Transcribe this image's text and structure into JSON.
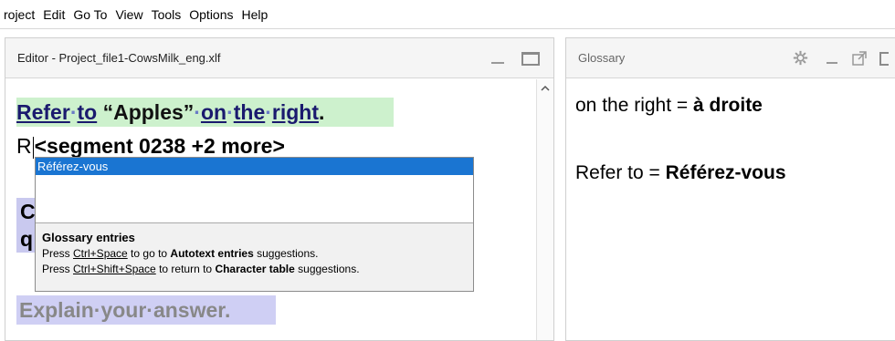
{
  "menubar": {
    "items": [
      "roject",
      "Edit",
      "Go To",
      "View",
      "Tools",
      "Options",
      "Help"
    ]
  },
  "editor": {
    "title": "Editor - Project_file1-CowsMilk_eng.xlf",
    "segment1": {
      "refer": "Refer",
      "dot1": "·",
      "to": "to",
      "space": " ",
      "apples": "“Apples”",
      "dot2": "·",
      "on": "on",
      "dot3": "·",
      "the": "the",
      "dot4": "·",
      "right": "right",
      "period": "."
    },
    "segment2": {
      "start": "R",
      "tag": "<segment 0238 +2 more>"
    },
    "segment3": {
      "line1": "C",
      "line2": "q"
    },
    "segment4": {
      "text": "Explain·your·answer."
    }
  },
  "popup": {
    "selected_item": "Référez-vous",
    "info_title": "Glossary entries",
    "line1_pre": "Press ",
    "line1_key": "Ctrl+Space",
    "line1_mid": " to go to ",
    "line1_bold": "Autotext entries",
    "line1_post": " suggestions.",
    "line2_pre": "Press ",
    "line2_key": "Ctrl+Shift+Space",
    "line2_mid": " to return to ",
    "line2_bold": "Character table",
    "line2_post": " suggestions."
  },
  "glossary": {
    "title": "Glossary",
    "entries": [
      {
        "source": "on the right = ",
        "target": "à droite"
      },
      {
        "source": "Refer to = ",
        "target": "Référez-vous"
      }
    ]
  }
}
